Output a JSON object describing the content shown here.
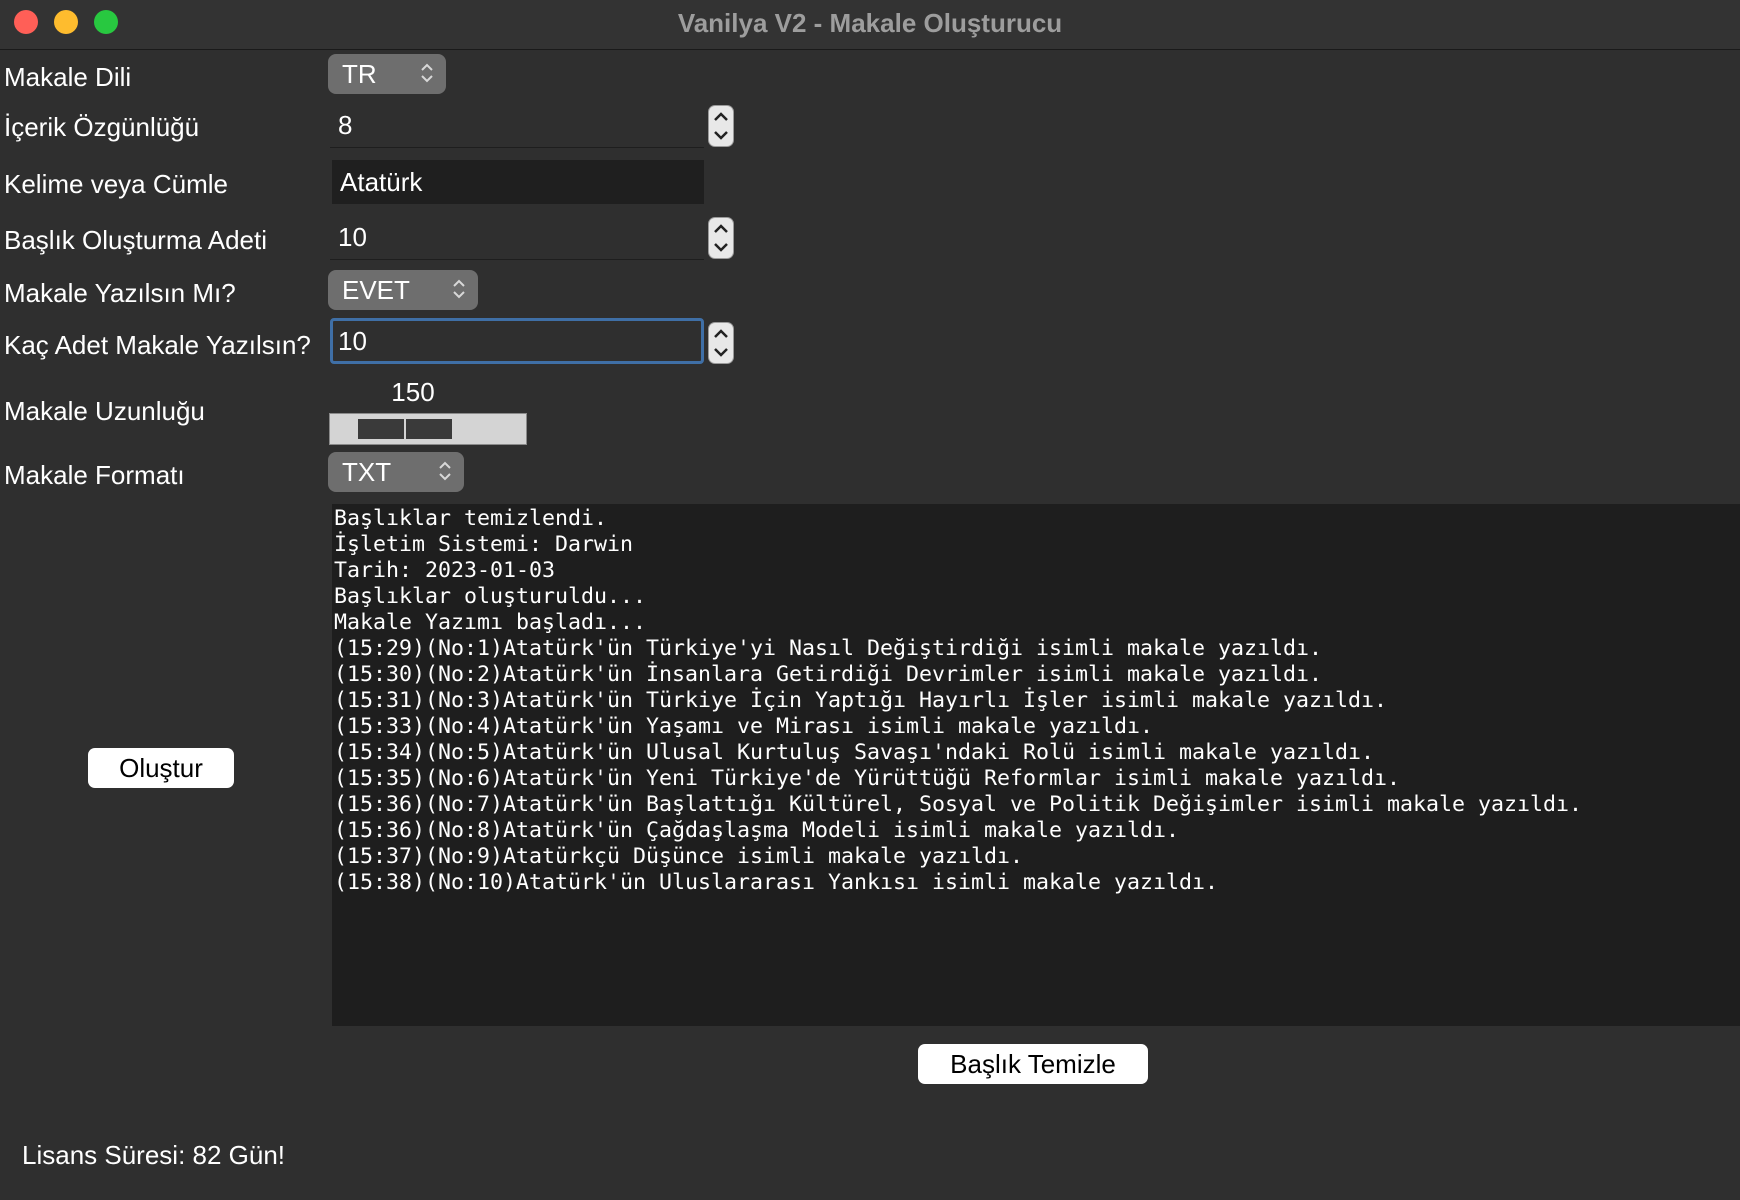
{
  "window": {
    "title": "Vanilya V2 - Makale Oluşturucu"
  },
  "form": {
    "language": {
      "label": "Makale Dili",
      "value": "TR"
    },
    "originality": {
      "label": "İçerik Özgünlüğü",
      "value": "8"
    },
    "keyword": {
      "label": "Kelime veya Cümle",
      "value": "Atatürk"
    },
    "title_count": {
      "label": "Başlık Oluşturma Adeti",
      "value": "10"
    },
    "write_articles": {
      "label": "Makale Yazılsın Mı?",
      "value": "EVET"
    },
    "article_count": {
      "label": "Kaç Adet Makale Yazılsın?",
      "value": "10"
    },
    "article_length": {
      "label": "Makale Uzunluğu",
      "value": "150"
    },
    "article_format": {
      "label": "Makale Formatı",
      "value": "TXT"
    }
  },
  "buttons": {
    "create": "Oluştur",
    "clear_titles": "Başlık Temizle"
  },
  "log": {
    "lines": [
      "Başlıklar temizlendi.",
      "İşletim Sistemi: Darwin",
      "Tarih: 2023-01-03",
      "Başlıklar oluşturuldu...",
      "Makale Yazımı başladı...",
      "(15:29)(No:1)Atatürk'ün Türkiye'yi Nasıl Değiştirdiği isimli makale yazıldı.",
      "(15:30)(No:2)Atatürk'ün İnsanlara Getirdiği Devrimler isimli makale yazıldı.",
      "(15:31)(No:3)Atatürk'ün Türkiye İçin Yaptığı Hayırlı İşler isimli makale yazıldı.",
      "(15:33)(No:4)Atatürk'ün Yaşamı ve Mirası isimli makale yazıldı.",
      "(15:34)(No:5)Atatürk'ün Ulusal Kurtuluş Savaşı'ndaki Rolü isimli makale yazıldı.",
      "(15:35)(No:6)Atatürk'ün Yeni Türkiye'de Yürüttüğü Reformlar isimli makale yazıldı.",
      "(15:36)(No:7)Atatürk'ün Başlattığı Kültürel, Sosyal ve Politik Değişimler isimli makale yazıldı.",
      "(15:36)(No:8)Atatürk'ün Çağdaşlaşma Modeli isimli makale yazıldı.",
      "(15:37)(No:9)Atatürkçü Düşünce isimli makale yazıldı.",
      "(15:38)(No:10)Atatürk'ün Uluslararası Yankısı isimli makale yazıldı."
    ]
  },
  "footer": {
    "license": "Lisans Süresi: 82 Gün!"
  },
  "colors": {
    "background": "#2f2f2f",
    "log_background": "#1e1e1e",
    "focus": "#3f6fa6"
  }
}
